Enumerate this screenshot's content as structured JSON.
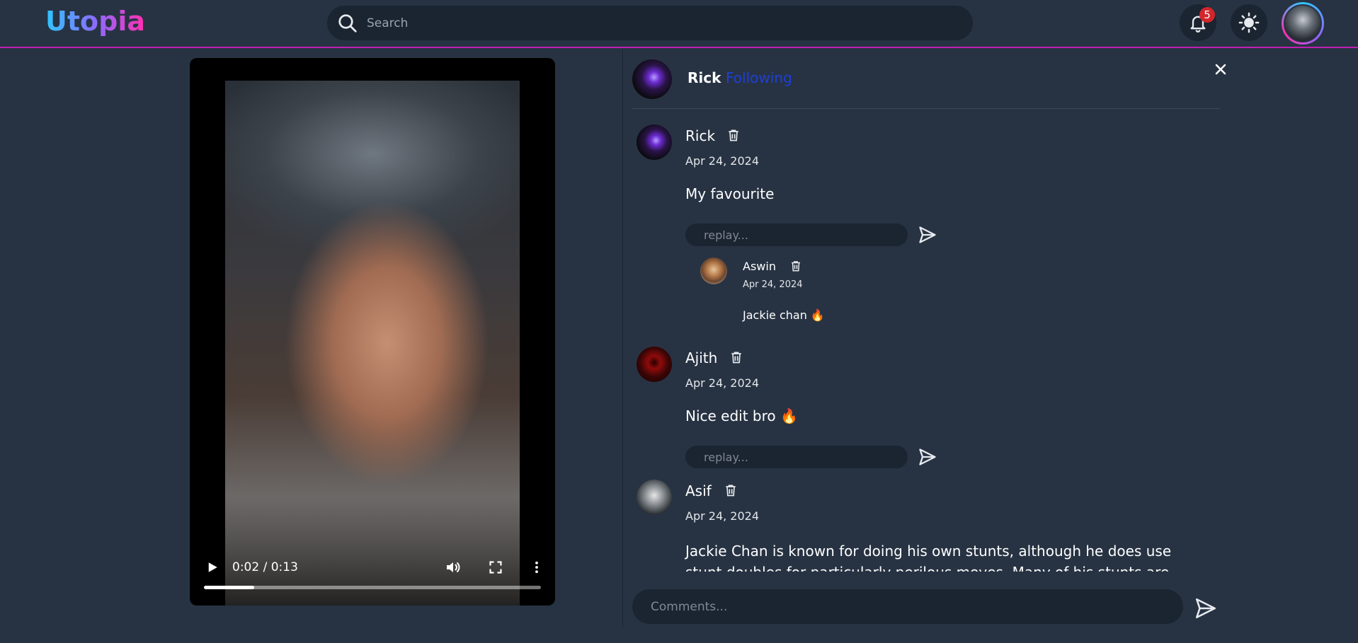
{
  "app": {
    "logo_text": "Utopia",
    "accent_colors": [
      "#2ec7ff",
      "#8b6bff",
      "#ff2fb0"
    ]
  },
  "header": {
    "search_placeholder": "Search",
    "notification_count": "5",
    "icons": [
      "search-icon",
      "bell-icon",
      "sun-icon"
    ]
  },
  "video": {
    "time_display": "0:02 / 0:13",
    "progress_fraction": 0.15
  },
  "post": {
    "author": "Rick",
    "follow_status": "Following"
  },
  "comments": [
    {
      "name": "Rick",
      "date": "Apr 24, 2024",
      "text": "My favourite",
      "reply_placeholder": "replay...",
      "replies": [
        {
          "name": "Aswin",
          "date": "Apr 24, 2024",
          "text": "Jackie chan 🔥"
        }
      ]
    },
    {
      "name": "Ajith",
      "date": "Apr 24, 2024",
      "text": "Nice edit bro 🔥",
      "reply_placeholder": "replay..."
    },
    {
      "name": "Asif",
      "date": "Apr 24, 2024",
      "text": "Jackie Chan is known for doing his own stunts, although he does use stunt doubles for particularly perilous moves. Many of his stunts are dangerous;"
    }
  ],
  "composer": {
    "placeholder": "Comments..."
  }
}
